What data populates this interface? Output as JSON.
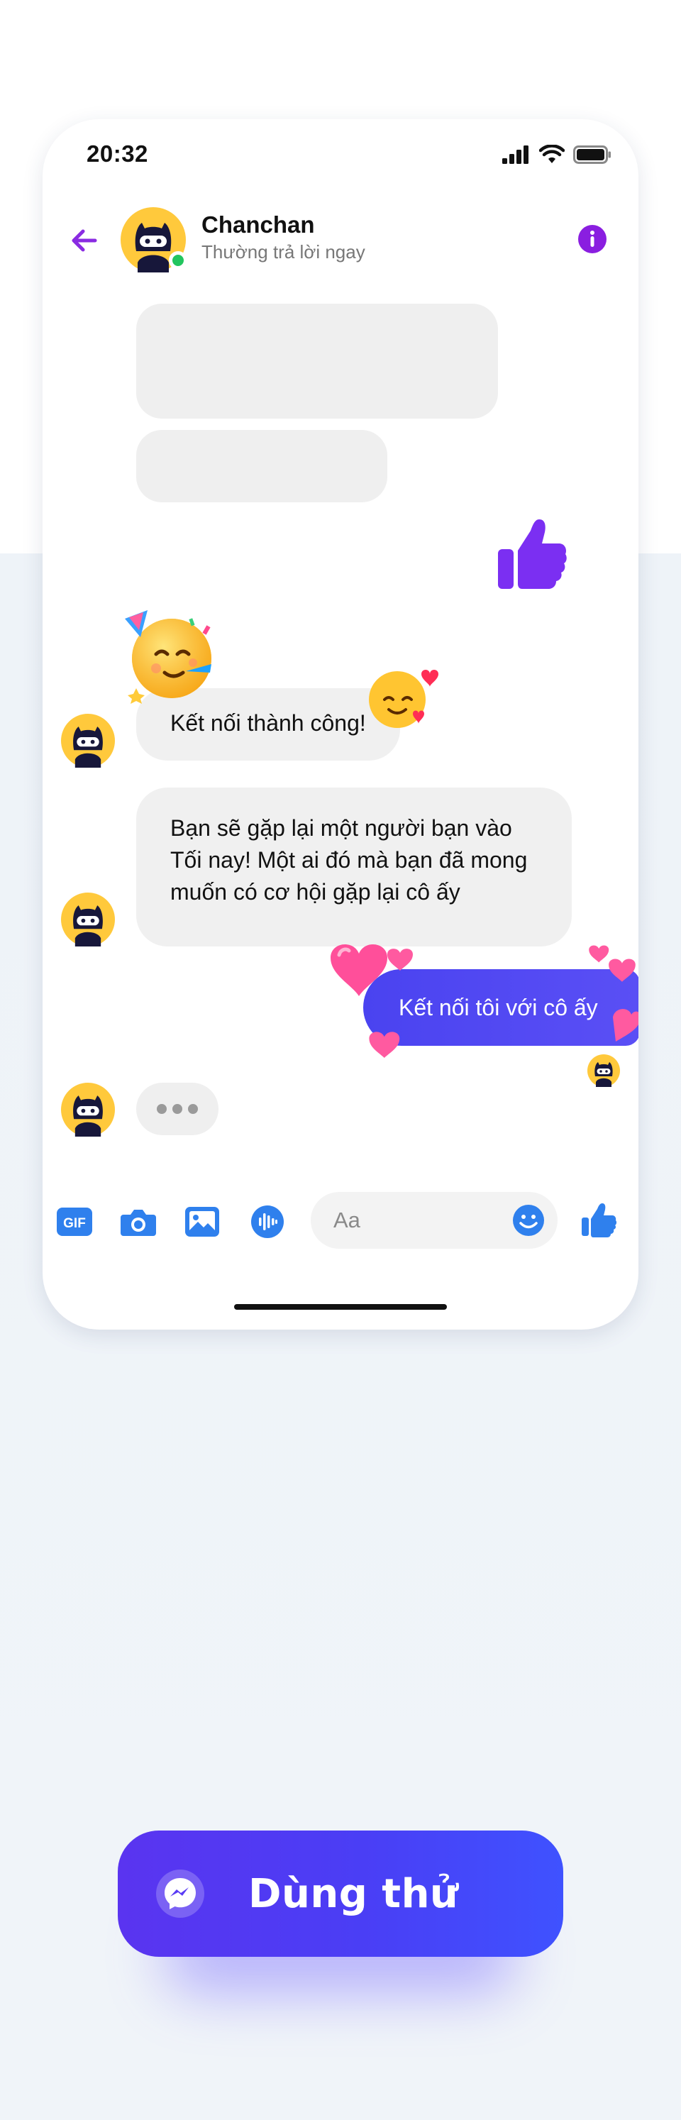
{
  "status_bar": {
    "time": "20:32"
  },
  "header": {
    "contact_name": "Chanchan",
    "contact_status": "Thường trả lời ngay"
  },
  "messages": {
    "incoming_1": "Kết nối thành công!",
    "incoming_2": "Bạn sẽ gặp lại một người bạn vào Tối nay! Một ai đó mà bạn đã mong muốn có cơ hội gặp lại cô ấy",
    "outgoing_1": "Kết nối tôi với cô ấy"
  },
  "composer": {
    "gif_label": "GIF",
    "placeholder": "Aa"
  },
  "cta": {
    "label": "Dùng thử"
  },
  "colors": {
    "accent_purple": "#8a2be2",
    "messenger_blue": "#2f80ed",
    "outgoing_bubble": "#4a43f0",
    "cta_gradient_start": "#5a34f0",
    "cta_gradient_end": "#3f52ff"
  },
  "icons": {
    "back": "back-arrow-icon",
    "info": "info-icon",
    "like": "thumbs-up-icon",
    "camera": "camera-icon",
    "image": "image-icon",
    "voice": "voice-icon",
    "emoji": "smiley-icon",
    "messenger": "messenger-icon"
  }
}
